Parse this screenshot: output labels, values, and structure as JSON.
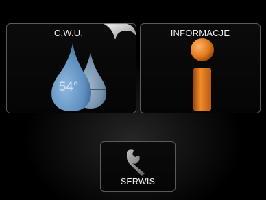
{
  "menu": {
    "hot_water": {
      "label": "C.W.U.",
      "temperature": "54°",
      "icon": "water-drops-icon"
    },
    "info": {
      "label": "INFORMACJE",
      "icon": "info-icon"
    },
    "service": {
      "label": "SERWIS",
      "icon": "wrench-icon"
    }
  },
  "colors": {
    "background": "#000000",
    "tile_border": "#5a5a5a",
    "drop_blue": "#5e8fbf",
    "info_orange": "#e07a1f",
    "wrench_gray": "#8a8a8a"
  }
}
